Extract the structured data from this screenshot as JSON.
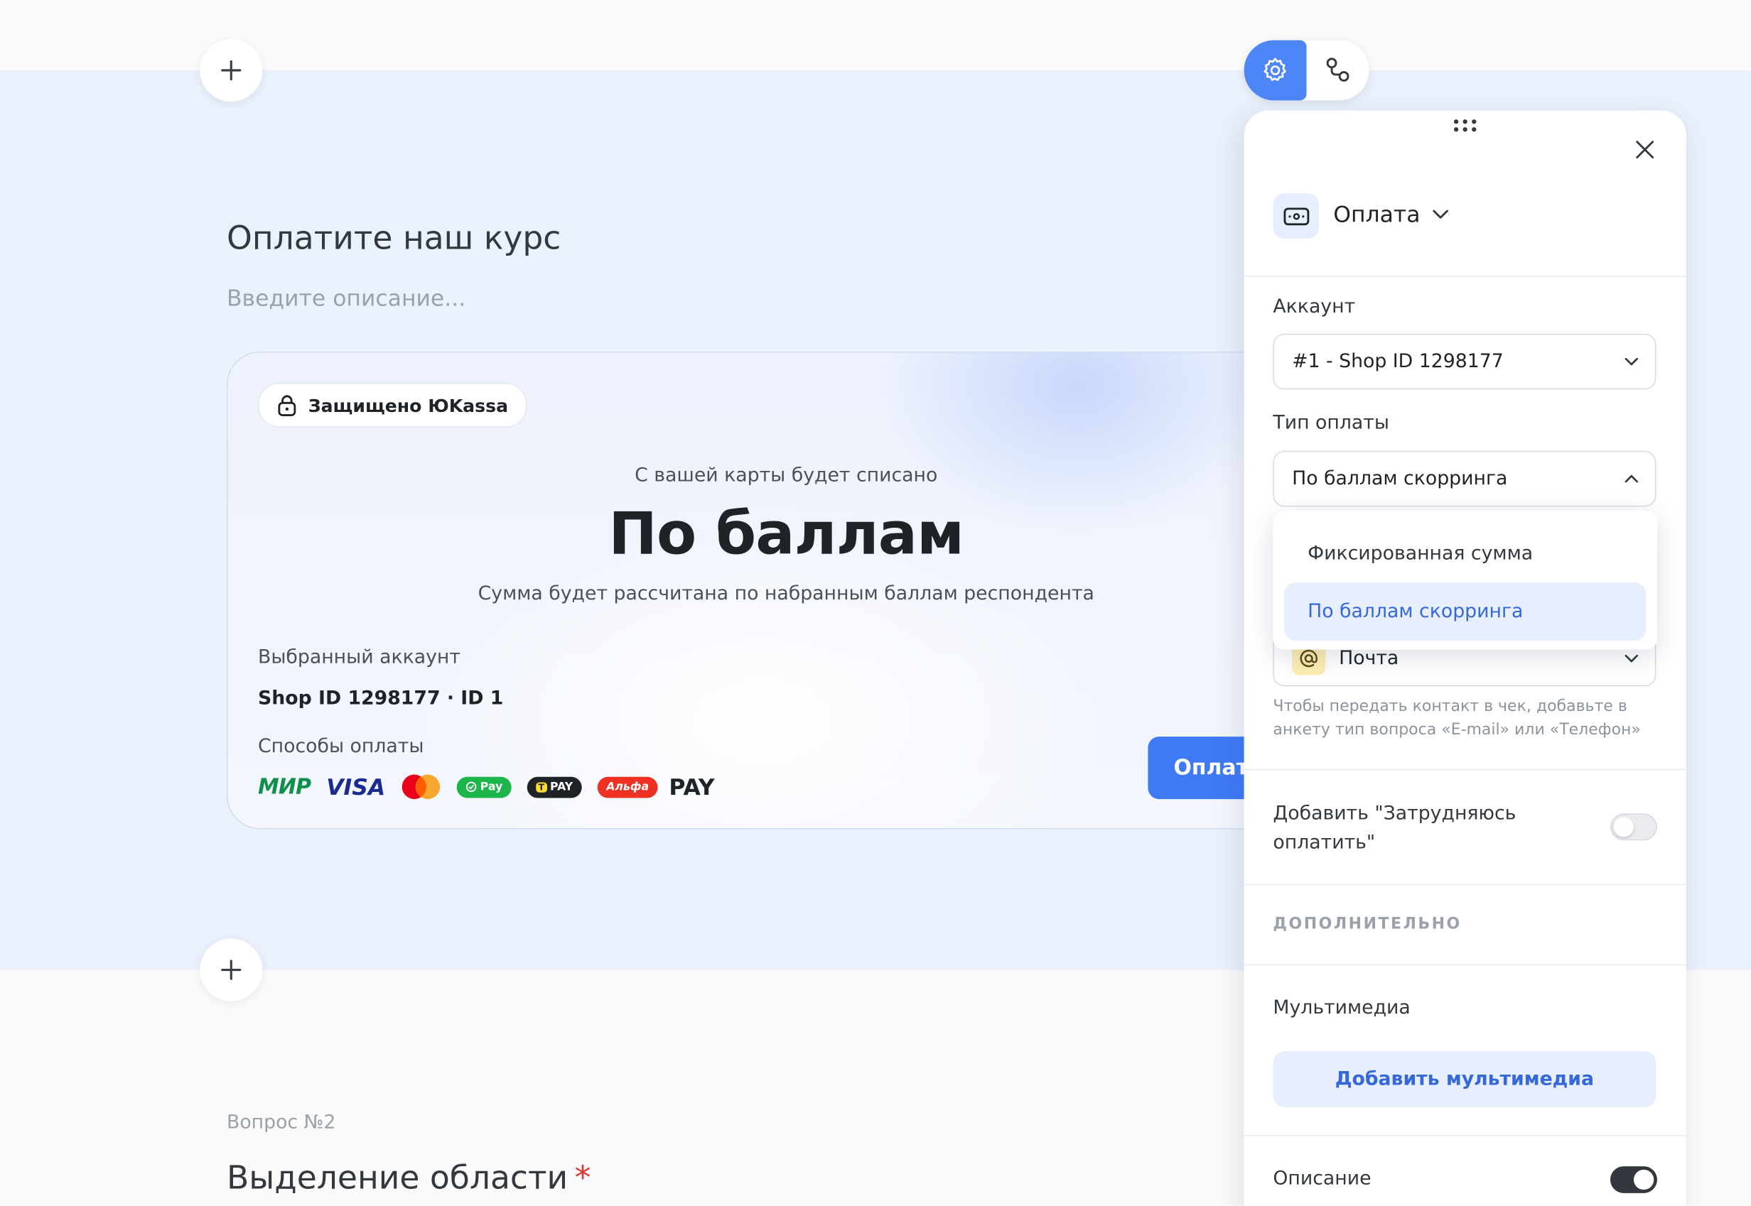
{
  "editor": {
    "page_title": "Оплатите наш курс",
    "description_placeholder": "Введите описание..."
  },
  "payment_card": {
    "secure_badge": "Защищено ЮKassa",
    "charge_caption": "С вашей карты будет списано",
    "amount": "По баллам",
    "amount_note": "Сумма будет рассчитана по набранным баллам респондента",
    "account_label": "Выбранный аккаунт",
    "account_value": "Shop ID 1298177 · ID 1",
    "methods_label": "Способы оплаты",
    "methods": {
      "mir": "МИР",
      "visa": "VISA",
      "sberpay": "Pay",
      "tpay": "PAY",
      "alfa": "Альфа",
      "alfa_pay": "PAY"
    },
    "pay_button": "Оплатить"
  },
  "question2": {
    "number": "Вопрос №2",
    "title": "Выделение области",
    "required_mark": "*"
  },
  "settings_panel": {
    "block_type": "Оплата",
    "account_label": "Аккаунт",
    "account_value": "#1 - Shop ID 1298177",
    "payment_type_label": "Тип оплаты",
    "payment_type_value": "По баллам скорринга",
    "payment_type_options": [
      {
        "label": "Фиксированная сумма",
        "selected": false
      },
      {
        "label": "По баллам скорринга",
        "selected": true
      }
    ],
    "email_value": "Почта",
    "email_hint": "Чтобы передать контакт в чек, добавьте в анкету тип вопроса «E-mail» или «Телефон»",
    "difficulty_toggle_label": "Добавить \"Затрудняюсь оплатить\"",
    "difficulty_toggle_on": false,
    "additional_section": "ДОПОЛНИТЕЛЬНО",
    "media_label": "Мультимедиа",
    "media_button": "Добавить мультимедиа",
    "description_label": "Описание",
    "description_toggle_on": true
  },
  "colors": {
    "accent": "#4d86f7",
    "accent_text": "#3569d8",
    "accent_soft": "#e7effe",
    "required": "#e5312b",
    "band": "#eaf0fc"
  }
}
